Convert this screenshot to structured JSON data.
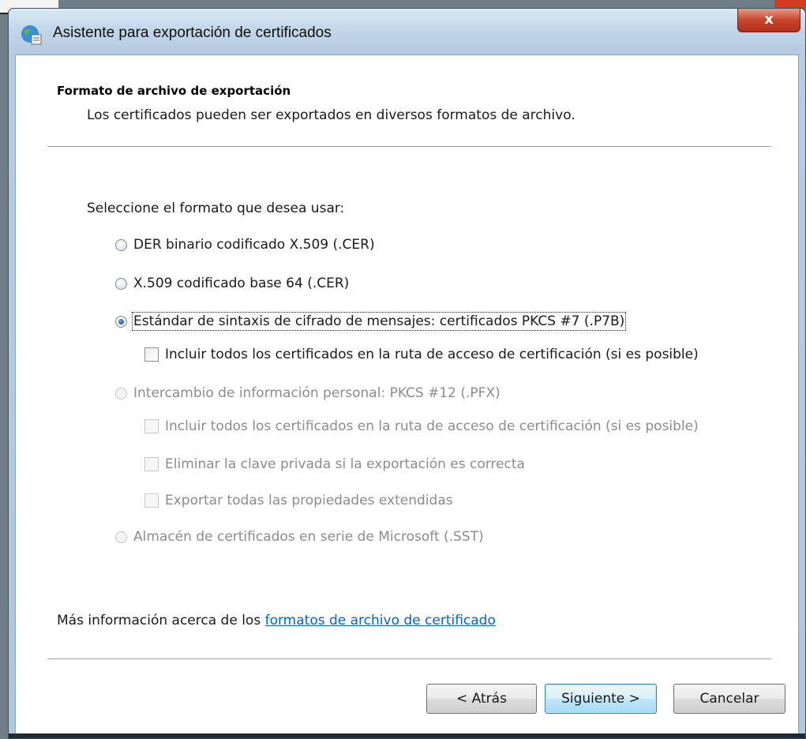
{
  "window": {
    "title": "Asistente para exportación de certificados",
    "close_label": "x"
  },
  "header": {
    "title": "Formato de archivo de exportación",
    "description": "Los certificados pueden ser exportados en diversos formatos de archivo."
  },
  "format": {
    "prompt": "Seleccione el formato que desea usar:",
    "options": [
      {
        "label": "DER binario codificado X.509 (.CER)",
        "checked": false,
        "enabled": true
      },
      {
        "label": "X.509 codificado base 64 (.CER)",
        "checked": false,
        "enabled": true
      },
      {
        "label": "Estándar de sintaxis de cifrado de mensajes: certificados PKCS #7 (.P7B)",
        "checked": true,
        "enabled": true
      },
      {
        "label": "Intercambio de información personal: PKCS #12 (.PFX)",
        "checked": false,
        "enabled": false
      },
      {
        "label": "Almacén de certificados en serie de Microsoft (.SST)",
        "checked": false,
        "enabled": false
      }
    ],
    "p7b_include_all": {
      "label": "Incluir todos los certificados en la ruta de acceso de certificación (si es posible)",
      "checked": false,
      "enabled": true
    },
    "pfx_include_all": {
      "label": "Incluir todos los certificados en la ruta de acceso de certificación (si es posible)",
      "checked": false,
      "enabled": false
    },
    "pfx_delete_key": {
      "label": "Eliminar la clave privada si la exportación es correcta",
      "checked": false,
      "enabled": false
    },
    "pfx_export_props": {
      "label": "Exportar todas las propiedades extendidas",
      "checked": false,
      "enabled": false
    }
  },
  "more_info": {
    "text": "Más información acerca de los ",
    "link": "formatos de archivo de certificado"
  },
  "buttons": {
    "back": "< Atrás",
    "next": "Siguiente >",
    "cancel": "Cancelar"
  },
  "colors": {
    "link": "#0066cc",
    "disabled_text": "#8c8c8c",
    "close_button": "#c9452b"
  }
}
